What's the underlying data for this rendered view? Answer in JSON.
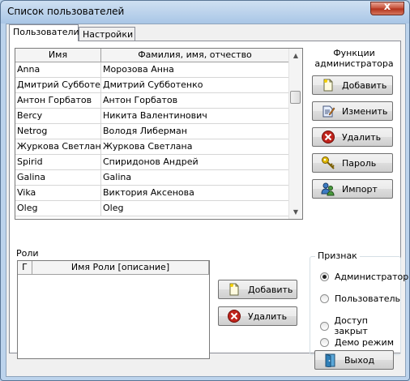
{
  "window": {
    "title": "Список пользователей",
    "close_glyph": "x"
  },
  "tabs": [
    {
      "label": "Пользователи",
      "active": true
    },
    {
      "label": "Настройки",
      "active": false
    }
  ],
  "users_table": {
    "columns": [
      "Имя",
      "Фамилия, имя, отчество"
    ],
    "rows": [
      [
        "Anna",
        "Морозова Анна"
      ],
      [
        "Дмитрий Субботенк",
        "Дмитрий Субботенко"
      ],
      [
        "Антон Горбатов",
        "Антон Горбатов"
      ],
      [
        "Bercy",
        "Никита Валентинович"
      ],
      [
        "Netrog",
        "Володя Либерман"
      ],
      [
        "Журкова Светлана",
        "Журкова Светлана"
      ],
      [
        "Spirid",
        "Спиридонов Андрей"
      ],
      [
        "Galina",
        "Galina"
      ],
      [
        "Vika",
        "Виктория Аксенова"
      ],
      [
        "Oleg",
        "Oleg"
      ]
    ]
  },
  "admin_functions": {
    "title": "Функции администратора",
    "buttons": [
      {
        "label": "Добавить",
        "icon": "new-document-icon"
      },
      {
        "label": "Изменить",
        "icon": "edit-document-icon"
      },
      {
        "label": "Удалить",
        "icon": "delete-icon"
      },
      {
        "label": "Пароль",
        "icon": "key-icon"
      },
      {
        "label": "Импорт",
        "icon": "import-users-icon"
      }
    ]
  },
  "roles": {
    "label": "Роли",
    "columns": [
      "Г",
      "Имя Роли [описание]"
    ],
    "add_label": "Добавить",
    "delete_label": "Удалить"
  },
  "attribute": {
    "legend": "Признак",
    "options": [
      "Администратор",
      "Пользователь",
      "Доступ закрыт",
      "Демо режим"
    ],
    "selected": "Администратор"
  },
  "footer": {
    "exit_label": "Выход",
    "exit_icon": "exit-door-icon"
  },
  "colors": {
    "title_bar": "#a9c6e6",
    "close_button": "#c44c35",
    "delete_icon": "#c0241c",
    "key_icon": "#e0b800"
  }
}
